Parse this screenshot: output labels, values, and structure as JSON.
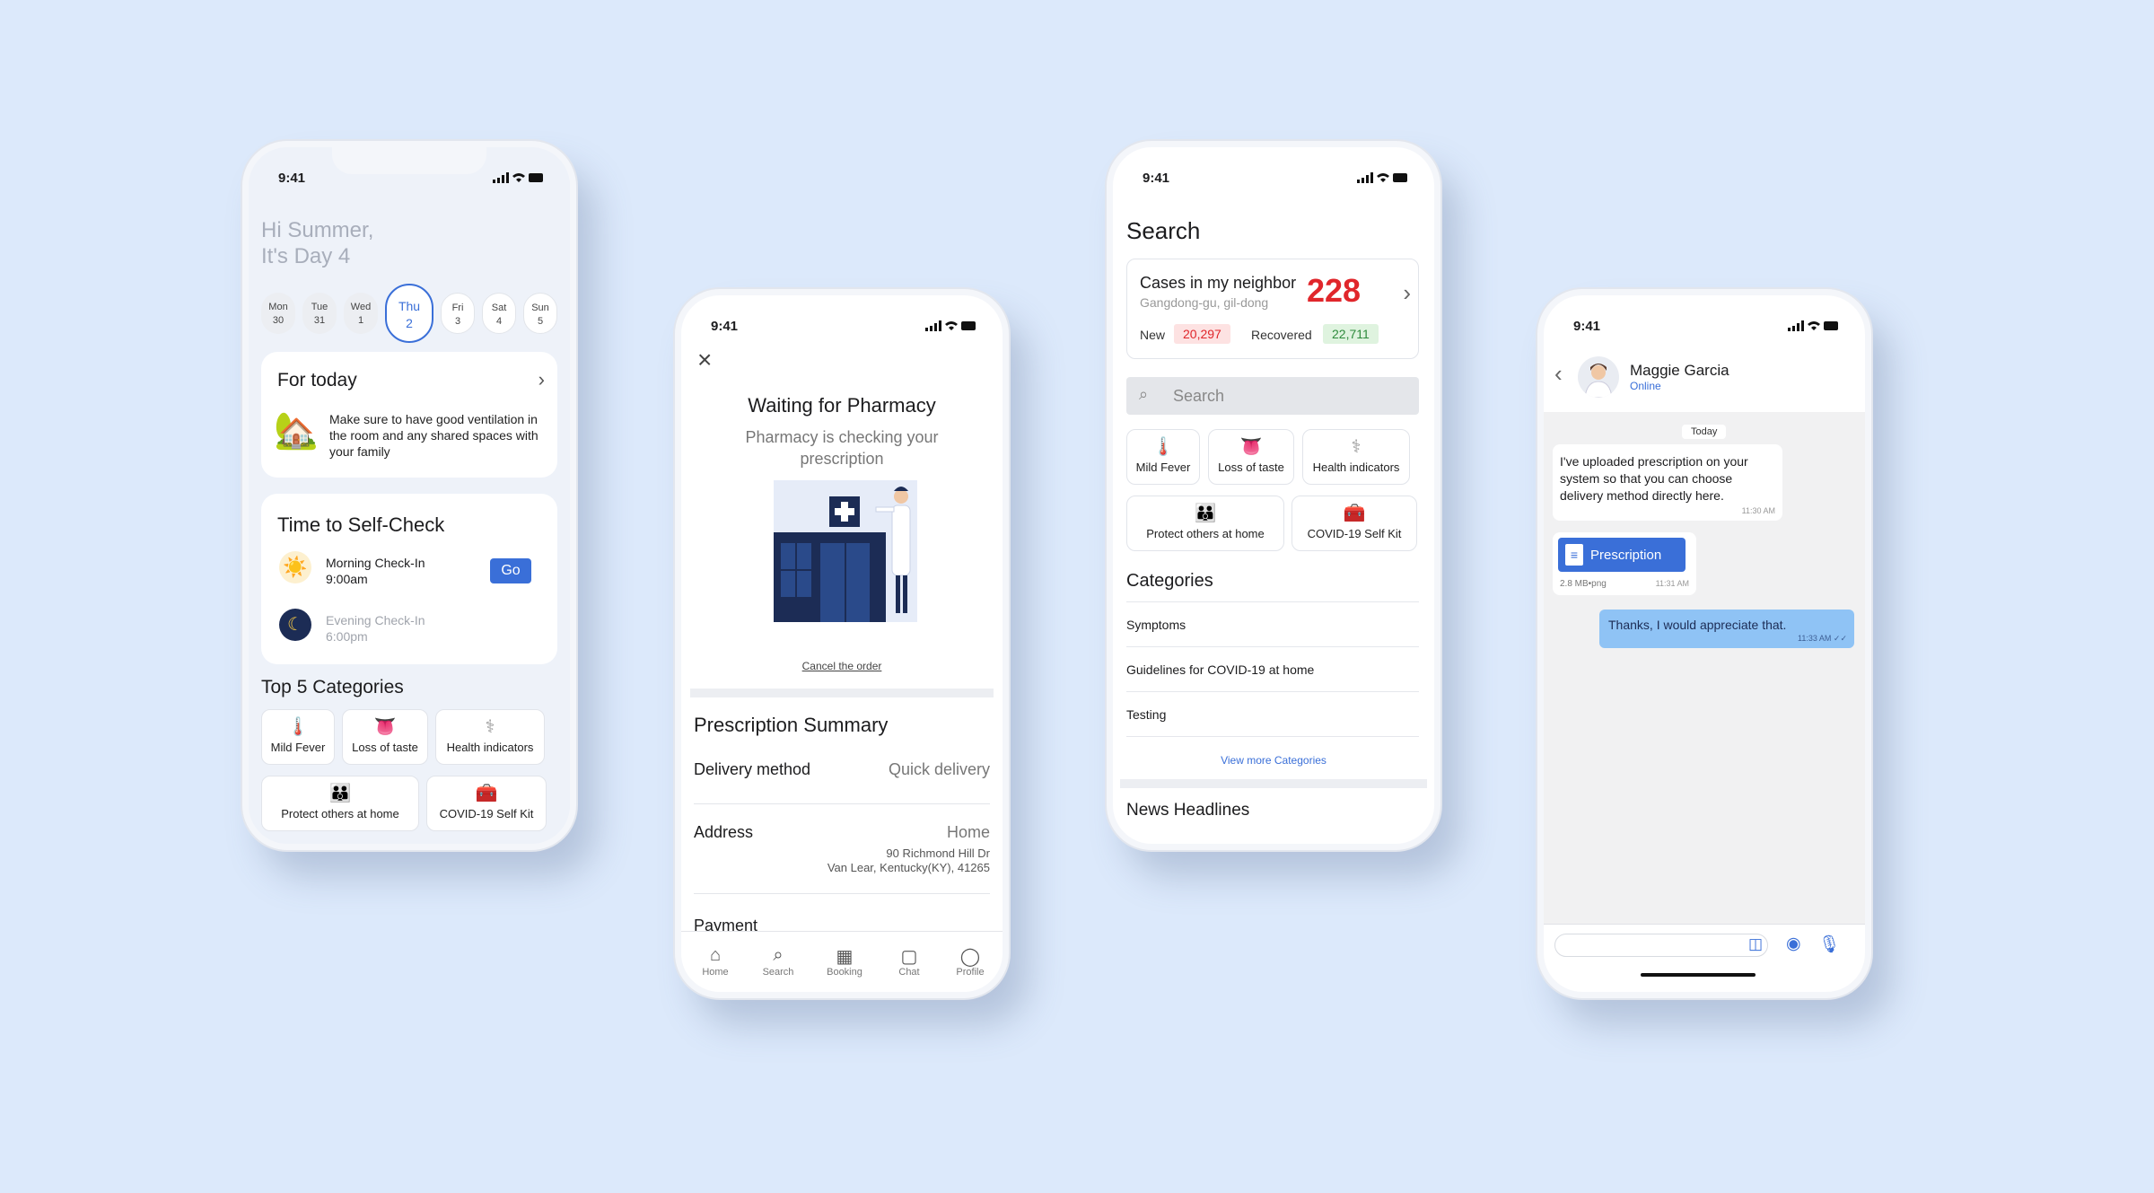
{
  "status_time": "9:41",
  "home": {
    "greeting_line1": "Hi Summer,",
    "greeting_line2": "It's Day 4",
    "days": [
      {
        "name": "Mon",
        "num": "30"
      },
      {
        "name": "Tue",
        "num": "31"
      },
      {
        "name": "Wed",
        "num": "1"
      },
      {
        "name": "Thu",
        "num": "2"
      },
      {
        "name": "Fri",
        "num": "3"
      },
      {
        "name": "Sat",
        "num": "4"
      },
      {
        "name": "Sun",
        "num": "5"
      }
    ],
    "for_today_title": "For today",
    "for_today_text": "Make sure to have good ventilation in the room and any shared spaces with your family",
    "selfcheck_title": "Time to Self-Check",
    "morning_label": "Morning Check-In",
    "morning_time": "9:00am",
    "go_label": "Go",
    "evening_label": "Evening Check-In",
    "evening_time": "6:00pm",
    "top5_title": "Top 5 Categories"
  },
  "categories": {
    "mild_fever": "Mild Fever",
    "loss_of_taste": "Loss of taste",
    "health_indicators": "Health indicators",
    "protect_others": "Protect others at home",
    "self_kit": "COVID-19 Self Kit"
  },
  "pharmacy": {
    "title": "Waiting for Pharmacy",
    "subtitle": "Pharmacy is checking your prescription",
    "cancel": "Cancel the order",
    "summary_title": "Prescription Summary",
    "delivery_label": "Delivery method",
    "delivery_value": "Quick delivery",
    "address_label": "Address",
    "address_value": "Home",
    "address_line1": "90 Richmond Hill Dr",
    "address_line2": "Van Lear, Kentucky(KY), 41265",
    "payment_label": "Payment",
    "nav": [
      "Home",
      "Search",
      "Booking",
      "Chat",
      "Profile"
    ]
  },
  "search": {
    "title": "Search",
    "cases_title": "Cases in my neighbor",
    "cases_location": "Gangdong-gu, gil-dong",
    "cases_count": "228",
    "new_label": "New",
    "new_value": "20,297",
    "recovered_label": "Recovered",
    "recovered_value": "22,711",
    "search_placeholder": "Search",
    "categories_title": "Categories",
    "category_list": [
      "Symptoms",
      "Guidelines for COVID-19 at home",
      "Testing"
    ],
    "view_more": "View more Categories",
    "news_title": "News Headlines"
  },
  "chat": {
    "contact_name": "Maggie Garcia",
    "contact_status": "Online",
    "date_chip": "Today",
    "msg1": "I've uploaded prescription on your system so that you can choose delivery method directly here.",
    "msg1_time": "11:30 AM",
    "file_name": "Prescription",
    "file_meta": "2.8 MB•png",
    "file_time": "11:31 AM",
    "msg2": "Thanks, I would appreciate that.",
    "msg2_time": "11:33 AM"
  },
  "colors": {
    "background": "#dce9fb",
    "accent": "#3a6fd8",
    "cases_red": "#e0262b",
    "new_bg": "#fde2e2",
    "recovered_bg": "#dff3df",
    "chat_bubble_out": "#8fc3f5"
  }
}
